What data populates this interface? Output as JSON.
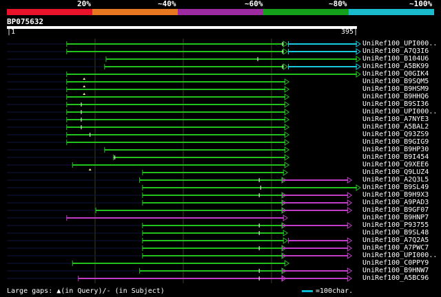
{
  "legend": {
    "labels": [
      "20%",
      "~40%",
      "~60%",
      "~80%",
      "~100%"
    ],
    "colors": [
      "#e8132a",
      "#e87722",
      "#9c2aa0",
      "#14a01a",
      "#19bacc"
    ]
  },
  "query": {
    "name": "BP075632",
    "start": "1",
    "end": "395",
    "length": 395
  },
  "colors": {
    "green": "#22c31c",
    "cyan": "#19c9de",
    "magenta": "#c23cc8",
    "faint": "#0f1640",
    "grid": "#3a3f1c"
  },
  "hits": [
    {
      "label": "UniRef100_UPI000..",
      "segments": [
        {
          "s": 0.0,
          "e": 20.5,
          "c": "faint"
        },
        {
          "s": 20.5,
          "e": 95.0,
          "c": "green"
        },
        {
          "s": 96.5,
          "e": 120,
          "c": "cyan"
        }
      ],
      "ticks": [
        94.5
      ],
      "tri": []
    },
    {
      "label": "UniRef100_A7Q3I6",
      "segments": [
        {
          "s": 0.0,
          "e": 20.5,
          "c": "faint"
        },
        {
          "s": 20.5,
          "e": 95.0,
          "c": "green"
        },
        {
          "s": 96.5,
          "e": 120,
          "c": "cyan"
        }
      ],
      "ticks": [
        94.5
      ],
      "tri": []
    },
    {
      "label": "UniRef100_B104U6",
      "segments": [
        {
          "s": 0.0,
          "e": 34.0,
          "c": "faint"
        },
        {
          "s": 34.0,
          "e": 120,
          "c": "green"
        }
      ],
      "ticks": [
        86.0
      ],
      "tri": []
    },
    {
      "label": "UniRef100_A5BK99",
      "segments": [
        {
          "s": 0.0,
          "e": 33.5,
          "c": "faint"
        },
        {
          "s": 33.5,
          "e": 95.0,
          "c": "green"
        },
        {
          "s": 96.5,
          "e": 120,
          "c": "cyan"
        }
      ],
      "ticks": [
        94.5
      ],
      "tri": []
    },
    {
      "label": "UniRef100_Q0GIK4",
      "segments": [
        {
          "s": 0.0,
          "e": 20.5,
          "c": "faint"
        },
        {
          "s": 20.5,
          "e": 120,
          "c": "green"
        }
      ],
      "ticks": [],
      "tri": []
    },
    {
      "label": "UniRef100_B9SQM5",
      "segments": [
        {
          "s": 0.0,
          "e": 20.5,
          "c": "faint"
        },
        {
          "s": 20.5,
          "e": 95.5,
          "c": "green"
        }
      ],
      "ticks": [],
      "tri": [
        26.5
      ]
    },
    {
      "label": "UniRef100_B9HSM9",
      "segments": [
        {
          "s": 0.0,
          "e": 20.5,
          "c": "faint"
        },
        {
          "s": 20.5,
          "e": 95.5,
          "c": "green"
        }
      ],
      "ticks": [],
      "tri": [
        26.5
      ]
    },
    {
      "label": "UniRef100_B9HHQ6",
      "segments": [
        {
          "s": 0.0,
          "e": 20.5,
          "c": "faint"
        },
        {
          "s": 20.5,
          "e": 95.5,
          "c": "green"
        }
      ],
      "ticks": [],
      "tri": [
        26.5
      ]
    },
    {
      "label": "UniRef100_B9SI36",
      "segments": [
        {
          "s": 0.0,
          "e": 20.5,
          "c": "faint"
        },
        {
          "s": 20.5,
          "e": 95.5,
          "c": "green"
        }
      ],
      "ticks": [
        25.5
      ],
      "tri": []
    },
    {
      "label": "UniRef100_UPI000..",
      "segments": [
        {
          "s": 0.0,
          "e": 20.5,
          "c": "faint"
        },
        {
          "s": 20.5,
          "e": 95.5,
          "c": "green"
        }
      ],
      "ticks": [
        25.5
      ],
      "tri": []
    },
    {
      "label": "UniRef100_A7NYE3",
      "segments": [
        {
          "s": 0.0,
          "e": 20.5,
          "c": "faint"
        },
        {
          "s": 20.5,
          "e": 95.5,
          "c": "green"
        }
      ],
      "ticks": [
        25.5
      ],
      "tri": []
    },
    {
      "label": "UniRef100_A5BAL2",
      "segments": [
        {
          "s": 0.0,
          "e": 20.5,
          "c": "faint"
        },
        {
          "s": 20.5,
          "e": 95.5,
          "c": "green"
        }
      ],
      "ticks": [
        25.5
      ],
      "tri": []
    },
    {
      "label": "UniRef100_Q93ZS9",
      "segments": [
        {
          "s": 0.0,
          "e": 20.5,
          "c": "faint"
        },
        {
          "s": 20.5,
          "e": 95.5,
          "c": "green"
        }
      ],
      "ticks": [
        28.5
      ],
      "tri": []
    },
    {
      "label": "UniRef100_B9GIG9",
      "segments": [
        {
          "s": 0.0,
          "e": 20.5,
          "c": "faint"
        },
        {
          "s": 20.5,
          "e": 95.5,
          "c": "green"
        }
      ],
      "ticks": [],
      "tri": []
    },
    {
      "label": "UniRef100_B9HP30",
      "segments": [
        {
          "s": 0.0,
          "e": 33.5,
          "c": "faint"
        },
        {
          "s": 33.5,
          "e": 95.5,
          "c": "green"
        }
      ],
      "ticks": [],
      "tri": []
    },
    {
      "label": "UniRef100_B9I454",
      "segments": [
        {
          "s": 0.0,
          "e": 36.5,
          "c": "faint"
        },
        {
          "s": 36.5,
          "e": 95.5,
          "c": "green"
        }
      ],
      "ticks": [
        37.0
      ],
      "tri": []
    },
    {
      "label": "UniRef100_Q9XEE6",
      "segments": [
        {
          "s": 0.0,
          "e": 22.5,
          "c": "faint"
        },
        {
          "s": 22.5,
          "e": 95.5,
          "c": "green"
        }
      ],
      "ticks": [],
      "tri": []
    },
    {
      "label": "UniRef100_Q9LUZ4",
      "segments": [
        {
          "s": 0.0,
          "e": 46.5,
          "c": "faint"
        },
        {
          "s": 46.5,
          "e": 95.0,
          "c": "green"
        }
      ],
      "ticks": [],
      "tri": [
        28.5
      ]
    },
    {
      "label": "UniRef100_A2Q3L5",
      "segments": [
        {
          "s": 0.0,
          "e": 45.5,
          "c": "faint"
        },
        {
          "s": 45.5,
          "e": 94.5,
          "c": "green"
        },
        {
          "s": 94.5,
          "e": 117,
          "c": "magenta"
        }
      ],
      "ticks": [
        86.5
      ],
      "tri": []
    },
    {
      "label": "UniRef100_B9SL49",
      "segments": [
        {
          "s": 0.0,
          "e": 46.5,
          "c": "faint"
        },
        {
          "s": 46.5,
          "e": 120,
          "c": "green"
        }
      ],
      "ticks": [
        87.0
      ],
      "tri": []
    },
    {
      "label": "UniRef100_B9H9X3",
      "segments": [
        {
          "s": 0.0,
          "e": 46.5,
          "c": "faint"
        },
        {
          "s": 46.5,
          "e": 94.5,
          "c": "green"
        },
        {
          "s": 94.5,
          "e": 117,
          "c": "magenta"
        }
      ],
      "ticks": [
        86.5
      ],
      "tri": []
    },
    {
      "label": "UniRef100_A9PAD3",
      "segments": [
        {
          "s": 0.0,
          "e": 46.5,
          "c": "faint"
        },
        {
          "s": 46.5,
          "e": 94.5,
          "c": "green"
        },
        {
          "s": 94.5,
          "e": 117,
          "c": "magenta"
        }
      ],
      "ticks": [],
      "tri": []
    },
    {
      "label": "UniRef100_B9GF07",
      "segments": [
        {
          "s": 0.0,
          "e": 30.5,
          "c": "faint"
        },
        {
          "s": 30.5,
          "e": 94.5,
          "c": "green"
        },
        {
          "s": 94.5,
          "e": 117,
          "c": "magenta"
        }
      ],
      "ticks": [],
      "tri": []
    },
    {
      "label": "UniRef100_B9HNP7",
      "segments": [
        {
          "s": 0.0,
          "e": 20.5,
          "c": "faint"
        },
        {
          "s": 20.5,
          "e": 95.0,
          "c": "magenta"
        }
      ],
      "ticks": [],
      "tri": []
    },
    {
      "label": "UniRef100_P93755",
      "segments": [
        {
          "s": 0.0,
          "e": 46.5,
          "c": "faint"
        },
        {
          "s": 46.5,
          "e": 94.5,
          "c": "green"
        },
        {
          "s": 94.5,
          "e": 117,
          "c": "magenta"
        }
      ],
      "ticks": [
        86.5
      ],
      "tri": []
    },
    {
      "label": "UniRef100_B9SL48",
      "segments": [
        {
          "s": 0.0,
          "e": 46.5,
          "c": "faint"
        },
        {
          "s": 46.5,
          "e": 95.0,
          "c": "green"
        }
      ],
      "ticks": [
        86.5
      ],
      "tri": []
    },
    {
      "label": "UniRef100_A7Q2A5",
      "segments": [
        {
          "s": 0.0,
          "e": 46.5,
          "c": "faint"
        },
        {
          "s": 46.5,
          "e": 95.0,
          "c": "green"
        },
        {
          "s": 96.5,
          "e": 117,
          "c": "magenta"
        }
      ],
      "ticks": [],
      "tri": []
    },
    {
      "label": "UniRef100_A7PWC7",
      "segments": [
        {
          "s": 0.0,
          "e": 46.5,
          "c": "faint"
        },
        {
          "s": 46.5,
          "e": 94.5,
          "c": "green"
        },
        {
          "s": 94.5,
          "e": 117,
          "c": "magenta"
        }
      ],
      "ticks": [
        86.5
      ],
      "tri": []
    },
    {
      "label": "UniRef100_UPI000..",
      "segments": [
        {
          "s": 0.0,
          "e": 46.5,
          "c": "faint"
        },
        {
          "s": 46.5,
          "e": 94.5,
          "c": "green"
        },
        {
          "s": 94.5,
          "e": 117,
          "c": "magenta"
        }
      ],
      "ticks": [],
      "tri": []
    },
    {
      "label": "UniRef100_C0PPY9",
      "segments": [
        {
          "s": 0.0,
          "e": 22.5,
          "c": "faint"
        },
        {
          "s": 22.5,
          "e": 95.5,
          "c": "green"
        }
      ],
      "ticks": [],
      "tri": []
    },
    {
      "label": "UniRef100_B9HNW7",
      "segments": [
        {
          "s": 0.0,
          "e": 45.5,
          "c": "faint"
        },
        {
          "s": 45.5,
          "e": 94.5,
          "c": "green"
        },
        {
          "s": 94.5,
          "e": 117,
          "c": "magenta"
        }
      ],
      "ticks": [
        86.5
      ],
      "tri": []
    },
    {
      "label": "UniRef100_A5BC96",
      "segments": [
        {
          "s": 0.0,
          "e": 24.5,
          "c": "faint"
        },
        {
          "s": 24.5,
          "e": 94.5,
          "c": "magenta"
        },
        {
          "s": 94.5,
          "e": 117,
          "c": "magenta"
        }
      ],
      "ticks": [
        86.5
      ],
      "tri": []
    }
  ],
  "footer": {
    "gaps_text": "Large gaps: ▲(in Query)/- (in Subject)",
    "scale_text": "=100char."
  }
}
